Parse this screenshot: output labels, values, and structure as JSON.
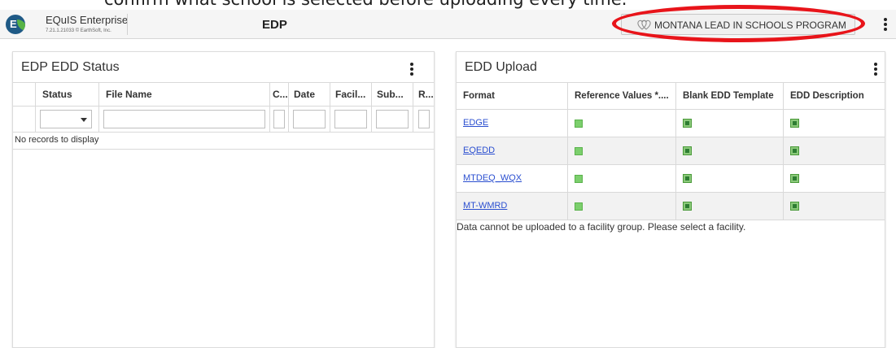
{
  "caption": {
    "text": "confirm what school is selected before uploading every time."
  },
  "header": {
    "brand": "EQuIS Enterprise",
    "version": "7.21.1.21033 © EarthSoft, Inc.",
    "page_title": "EDP",
    "program_button": "MONTANA LEAD IN SCHOOLS PROGRAM",
    "icons": {
      "logo": "equis-logo",
      "program": "hearts-icon",
      "menu": "more-vert-icon"
    },
    "annotation_color": "#e8141a"
  },
  "status_panel": {
    "title": "EDP EDD Status",
    "columns": [
      "Status",
      "File Name",
      "C...",
      "Date",
      "Facil...",
      "Sub...",
      "R..."
    ],
    "empty_message": "No records to display"
  },
  "upload_panel": {
    "title": "EDD Upload",
    "columns": [
      "Format",
      "Reference Values *....",
      "Blank EDD Template",
      "EDD Description"
    ],
    "rows": [
      {
        "format": "EDGE"
      },
      {
        "format": "EQEDD"
      },
      {
        "format": "MTDEQ_WQX"
      },
      {
        "format": "MT-WMRD"
      }
    ],
    "note": "Data cannot be uploaded to a facility group. Please select a facility."
  }
}
